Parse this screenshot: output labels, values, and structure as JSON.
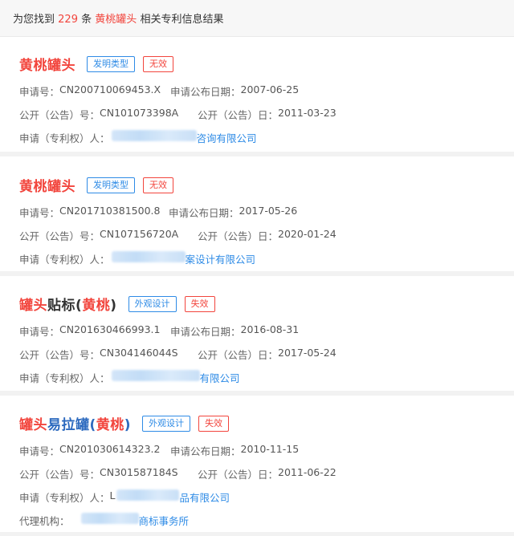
{
  "summary": {
    "prefix": "为您找到",
    "count": "229",
    "unit": "条",
    "keyword": "黄桃罐头",
    "suffix": "相关专利信息结果"
  },
  "results": [
    {
      "title_parts": [
        {
          "text": "黄桃罐头",
          "hl": true
        }
      ],
      "type_tag": "发明类型",
      "status_tag": "无效",
      "labels": {
        "app_no": "申请号：",
        "app_pub_date": "申请公布日期：",
        "pub_no": "公开（公告）号：",
        "pub_date": "公开（公告）日：",
        "applicant": "申请（专利权）人："
      },
      "app_no": "CN200710069453.X",
      "app_pub_date": "2007-06-25",
      "pub_no": "CN101073398A",
      "pub_date": "2011-03-23",
      "applicant_visible": "咨询有限公司"
    },
    {
      "title_parts": [
        {
          "text": "黄桃罐头",
          "hl": true
        }
      ],
      "type_tag": "发明类型",
      "status_tag": "无效",
      "labels": {
        "app_no": "申请号：",
        "app_pub_date": "申请公布日期：",
        "pub_no": "公开（公告）号：",
        "pub_date": "公开（公告）日：",
        "applicant": "申请（专利权）人："
      },
      "app_no": "CN201710381500.8",
      "app_pub_date": "2017-05-26",
      "pub_no": "CN107156720A",
      "pub_date": "2020-01-24",
      "applicant_visible": "案设计有限公司"
    },
    {
      "title_parts": [
        {
          "text": "罐头",
          "hl": true
        },
        {
          "text": "贴标(",
          "hl": false
        },
        {
          "text": "黄桃",
          "hl": true
        },
        {
          "text": ")",
          "hl": false
        }
      ],
      "type_tag": "外观设计",
      "status_tag": "失效",
      "labels": {
        "app_no": "申请号：",
        "app_pub_date": "申请公布日期：",
        "pub_no": "公开（公告）号：",
        "pub_date": "公开（公告）日：",
        "applicant": "申请（专利权）人："
      },
      "app_no": "CN201630466993.1",
      "app_pub_date": "2016-08-31",
      "pub_no": "CN304146044S",
      "pub_date": "2017-05-24",
      "applicant_visible": "有限公司"
    },
    {
      "title_parts": [
        {
          "text": "罐头",
          "hl": true
        },
        {
          "text": "易拉罐(",
          "hl": false
        },
        {
          "text": "黄桃",
          "hl": true
        },
        {
          "text": ")",
          "hl": false
        }
      ],
      "type_tag": "外观设计",
      "status_tag": "失效",
      "labels": {
        "app_no": "申请号：",
        "app_pub_date": "申请公布日期：",
        "pub_no": "公开（公告）号：",
        "pub_date": "公开（公告）日：",
        "applicant": "申请（专利权）人：",
        "agency": "代理机构："
      },
      "app_no": "CN201030614323.2",
      "app_pub_date": "2010-11-15",
      "pub_no": "CN301587184S",
      "pub_date": "2011-06-22",
      "applicant_prefix": "L",
      "applicant_visible": "品有限公司",
      "agency_visible": "商标事务所"
    }
  ]
}
